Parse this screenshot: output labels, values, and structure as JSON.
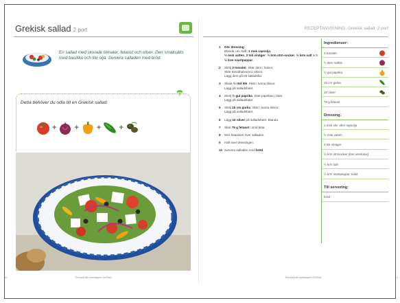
{
  "left_page": {
    "title": "Grekisk sallad",
    "portions": "2 port",
    "intro": "En sallad med skivade tomater, fetaost och oliver. Den smaksätts med basilika och lite olja. Servera salladen med bröd.",
    "grow_heading": "Detta behöver du odla till en Grekisk sallad:",
    "vegetables": [
      "tomato-icon",
      "onion-icon",
      "pepper-icon",
      "cucumber-icon",
      "olive-icon"
    ],
    "folio_page": "34",
    "folio_center": "Recept från spelappen GoGlad"
  },
  "right_page": {
    "header": "RECEPTANVISNING: Grekisk sallad, 2 port",
    "steps": [
      {
        "n": "1",
        "html": "<b>Gör dressing:</b><br>Blanda i en skål: <b>1 msk rapsolja</b>,<br><b>½ msk vatten</b>, <b>2 tsk vinäger</b>, <b>½ krm strö-socker</b>, <b>½ krm salt</b> och <b>½ krm svartpeppar</b>."
      },
      {
        "n": "2",
        "html": "Skölj <b>3 tomater</b>. Skär dem i halvor.<br>Skär tomathalvorna i skivor.<br>Lägg dem på ett salladsfat."
      },
      {
        "n": "3",
        "html": "Skala <b>½ röd lök</b>. Skär i tunna skivor.<br>Lägg på salladsfatet."
      },
      {
        "n": "4",
        "html": "Skölj <b>½ gul paprika</b>. Skär paprikan i bitar.<br>Lägg på salladsfatet."
      },
      {
        "n": "5",
        "html": "Skölj <b>10 cm gurka</b>. Skär i tunna skivor.<br>Lägg på salladsfatet."
      },
      {
        "n": "6",
        "html": "Lägg <b>10 oliver</b> på salladsfatet. Blanda."
      },
      {
        "n": "7",
        "html": "Skär <b>75 g fetaost</b> i små bitar."
      },
      {
        "n": "8",
        "html": "Strö fetaosten över salladen."
      },
      {
        "n": "9",
        "html": "Häll över dressingen."
      },
      {
        "n": "10",
        "html": "Servera salladen med <b>bröd</b>."
      }
    ],
    "ingredients_title": "Ingredienser:",
    "ingredients": [
      {
        "label": "3 tomater",
        "icon": "tomato-icon"
      },
      {
        "label": "½ liten rödlök",
        "icon": "onion-icon"
      },
      {
        "label": "½ gul paprika",
        "icon": "pepper-icon"
      },
      {
        "label": "10 cm gurka",
        "icon": "cucumber-icon"
      },
      {
        "label": "10 oliver",
        "icon": "olive-icon"
      },
      {
        "label": "75 g fetaost",
        "icon": ""
      }
    ],
    "dressing_title": "Dressing:",
    "dressing": [
      "1 msk oliv- eller rapsolja",
      "½ msk vatten",
      "2 tsk vinäger",
      "½ krm strösocker (kan uteslutas)",
      "½ krm salt",
      "½ krm svartpeppar, mald"
    ],
    "serving_title": "Till servering:",
    "serving": [
      "bröd"
    ],
    "folio_center": "Recept från spelappen GoGlad",
    "folio_page": "3"
  },
  "colors": {
    "accent_green": "#7fb85a",
    "tomato": "#d93b2b",
    "onion": "#8e2a56",
    "pepper": "#f5a10f",
    "cucumber": "#2e8a1f",
    "olive": "#4a4a22"
  }
}
